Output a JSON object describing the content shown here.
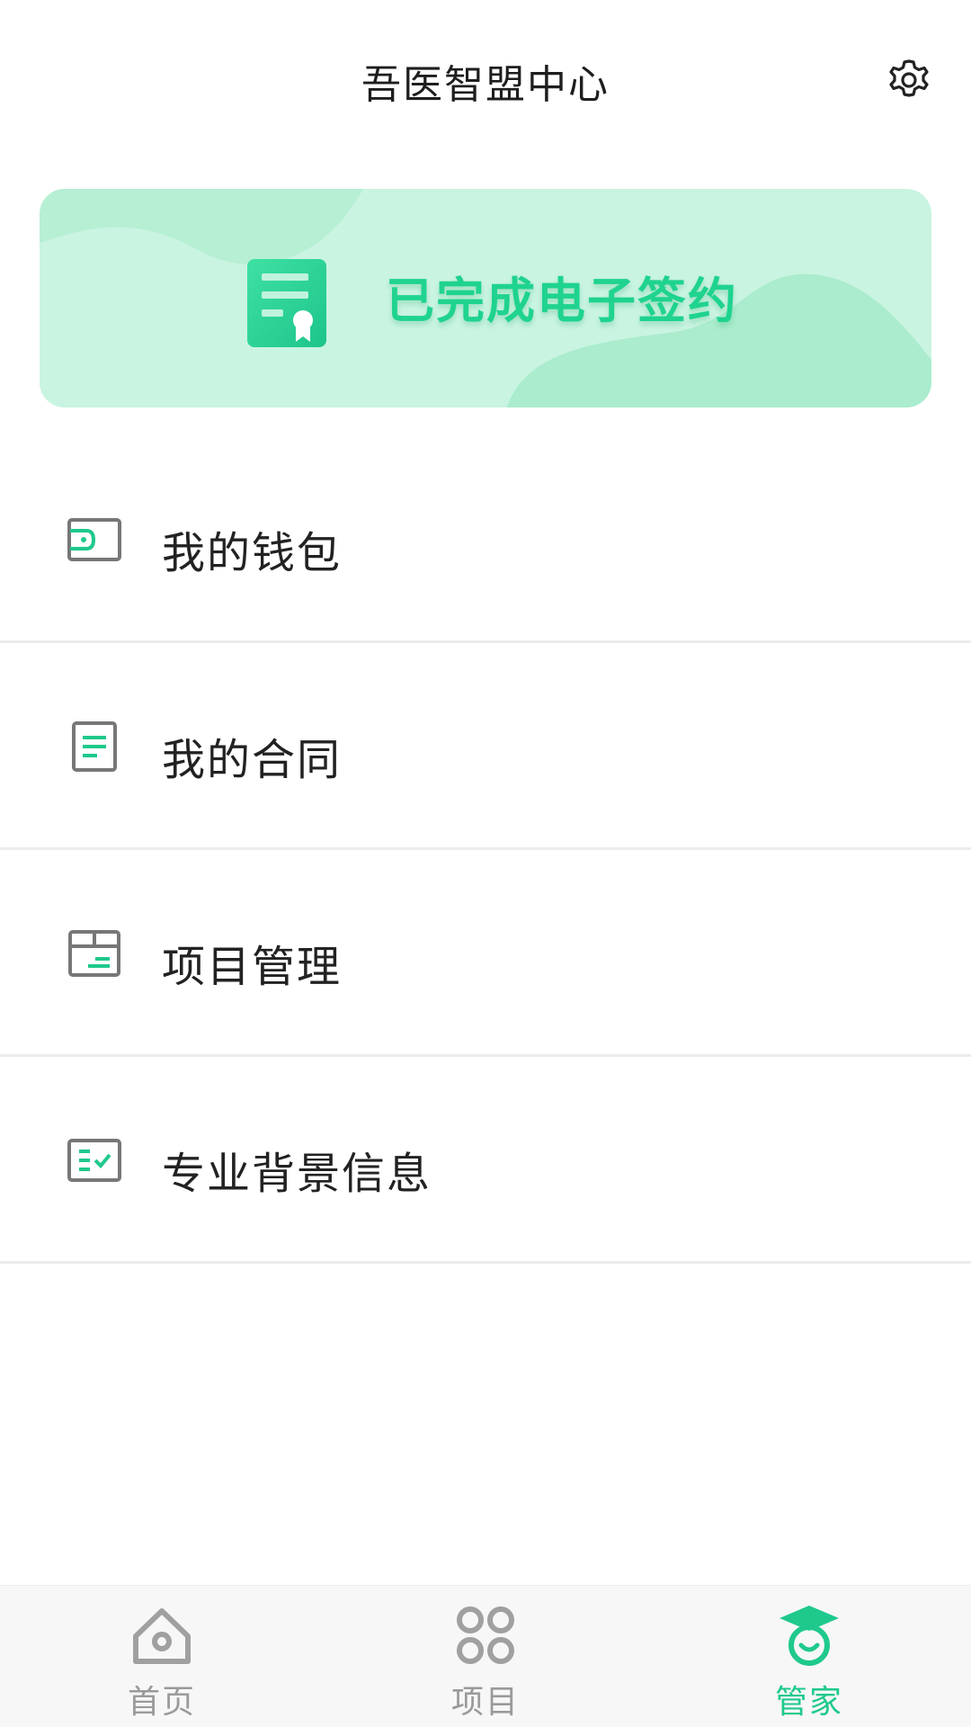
{
  "header": {
    "title": "吾医智盟中心",
    "settings_icon": "gear-icon"
  },
  "banner": {
    "text": "已完成电子签约",
    "icon": "certificate-icon",
    "colors": {
      "bg": "#c9f4e1",
      "accent": "#1fd38f"
    }
  },
  "menu": {
    "items": [
      {
        "label": "我的钱包",
        "icon": "wallet-icon"
      },
      {
        "label": "我的合同",
        "icon": "contract-icon"
      },
      {
        "label": "项目管理",
        "icon": "project-box-icon"
      },
      {
        "label": "专业背景信息",
        "icon": "checklist-icon"
      }
    ]
  },
  "tabbar": {
    "items": [
      {
        "label": "首页",
        "icon": "home-icon",
        "active": false
      },
      {
        "label": "项目",
        "icon": "grid-circles-icon",
        "active": false
      },
      {
        "label": "管家",
        "icon": "graduation-cap-icon",
        "active": true
      }
    ],
    "colors": {
      "active": "#1fc98c",
      "inactive": "#9a9a9a"
    }
  }
}
